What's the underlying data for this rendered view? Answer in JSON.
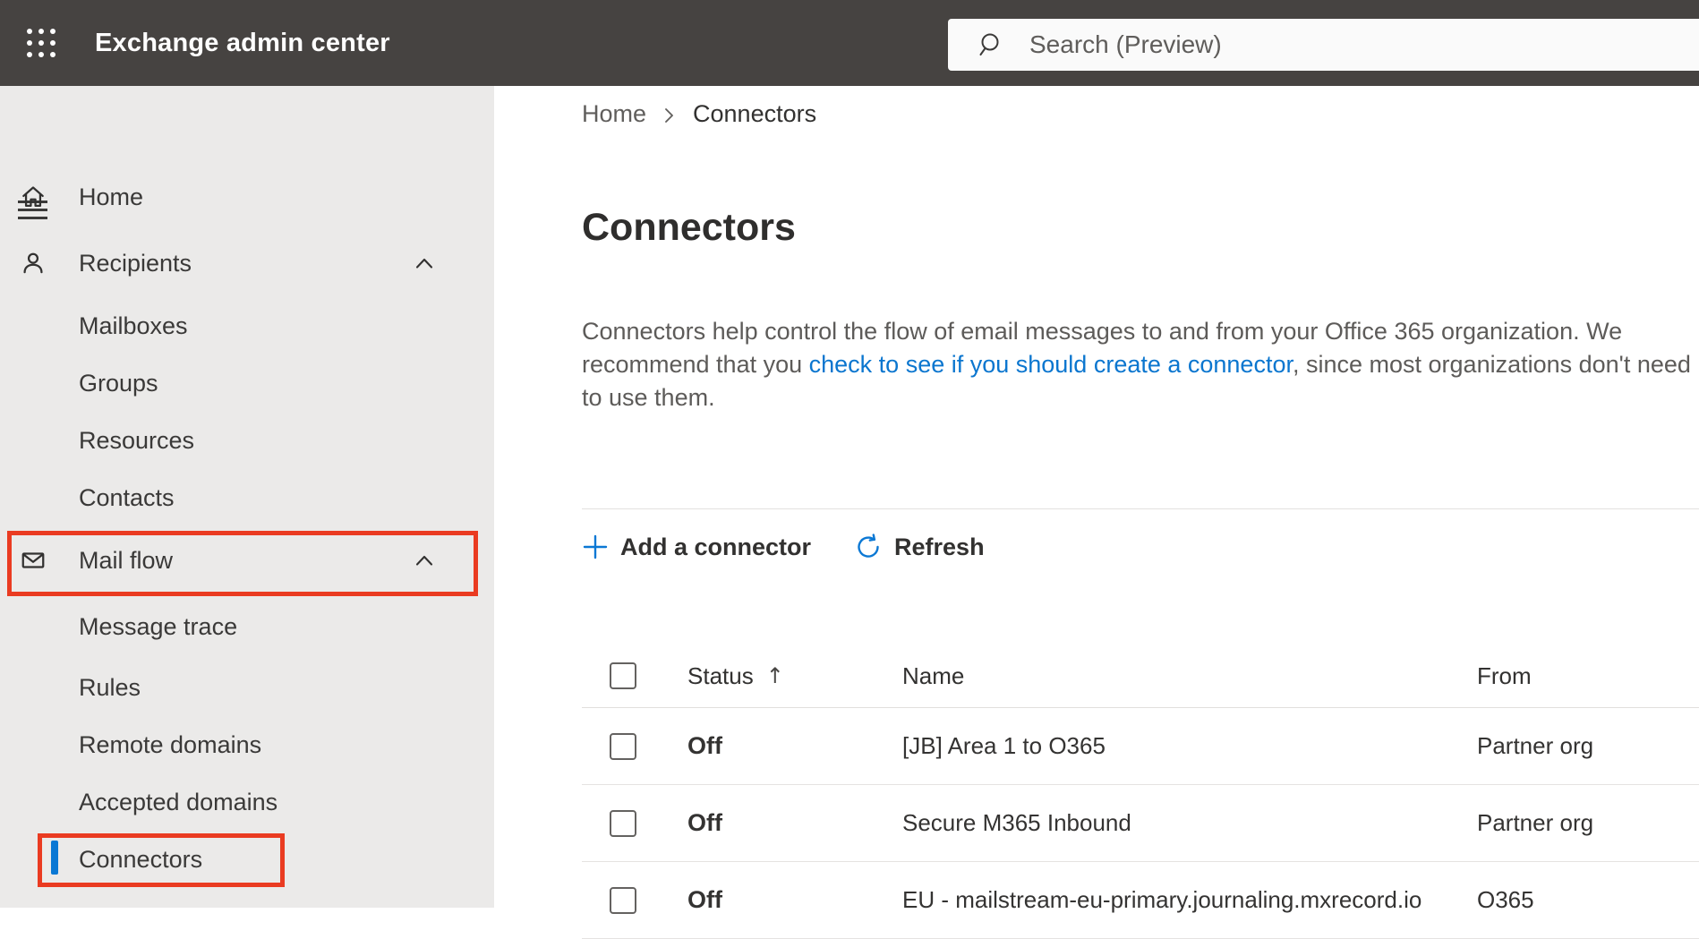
{
  "header": {
    "app_title": "Exchange admin center",
    "search_placeholder": "Search (Preview)"
  },
  "sidebar": {
    "items": [
      {
        "label": "Home",
        "icon": "home-icon",
        "level": 0
      },
      {
        "label": "Recipients",
        "icon": "person-icon",
        "level": 0,
        "expanded": true
      },
      {
        "label": "Mailboxes",
        "level": 1
      },
      {
        "label": "Groups",
        "level": 1
      },
      {
        "label": "Resources",
        "level": 1
      },
      {
        "label": "Contacts",
        "level": 1
      },
      {
        "label": "Mail flow",
        "icon": "mail-icon",
        "level": 0,
        "expanded": true,
        "annotated": true
      },
      {
        "label": "Message trace",
        "level": 1
      },
      {
        "label": "Rules",
        "level": 1
      },
      {
        "label": "Remote domains",
        "level": 1
      },
      {
        "label": "Accepted domains",
        "level": 1
      },
      {
        "label": "Connectors",
        "level": 1,
        "selected": true,
        "annotated": true
      }
    ]
  },
  "breadcrumb": {
    "items": [
      "Home",
      "Connectors"
    ]
  },
  "page": {
    "title": "Connectors",
    "description": {
      "before": "Connectors help control the flow of email messages to and from your Office 365 organization. We recommend that you ",
      "link": "check to see if you should create a connector",
      "after": ", since most organizations don't need to use them."
    }
  },
  "toolbar": {
    "add_label": "Add a connector",
    "refresh_label": "Refresh"
  },
  "table": {
    "columns": [
      "Status",
      "Name",
      "From"
    ],
    "sort_indicator": "↑",
    "sorted_by": "Status",
    "rows": [
      {
        "status": "Off",
        "name": "[JB] Area 1 to O365",
        "from": "Partner org"
      },
      {
        "status": "Off",
        "name": "Secure M365 Inbound",
        "from": "Partner org"
      },
      {
        "status": "Off",
        "name": "EU - mailstream-eu-primary.journaling.mxrecord.io",
        "from": "O365"
      }
    ]
  },
  "colors": {
    "accent_blue": "#0b78d4",
    "link_blue": "#0b76cf",
    "annotation_red": "#ea3b21",
    "topbar": "#464341",
    "sidebar_bg": "#ebeae9"
  }
}
